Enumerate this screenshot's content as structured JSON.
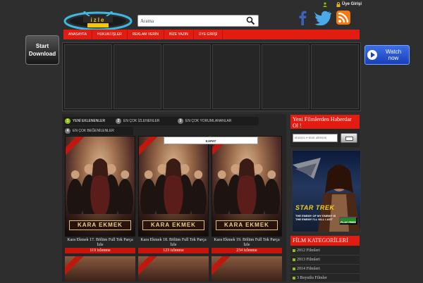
{
  "header": {
    "logo_text": "izle",
    "search": {
      "placeholder": "Arama",
      "value": "Arama"
    },
    "user_link": "Üye Girişi"
  },
  "nav": {
    "items": [
      "ANASAYFA",
      "HUKUKİ İŞLER",
      "REKLAM VERİN",
      "BİZE YAZIN",
      "ÜYE GİRİŞİ"
    ]
  },
  "ads": {
    "start_download": "Start Download",
    "watch_now": "Watch now",
    "startrek": {
      "logo": "STAR TREK",
      "tagline": "THE ENEMY OF MY ENEMY IS THE ENEMY I'LL KILL LAST",
      "play": "PLAY FREE"
    }
  },
  "tabs": [
    {
      "num": "1",
      "label": "YENİ EKLENENLER"
    },
    {
      "num": "2",
      "label": "EN ÇOK İZLENENLER"
    },
    {
      "num": "3",
      "label": "EN ÇOK YORUMLANANLAR"
    },
    {
      "num": "4",
      "label": "EN ÇOK BEĞENİLENLER"
    }
  ],
  "popup": {
    "close_label": "KAPAT"
  },
  "movies": [
    {
      "poster_title": "KARA EKMEK",
      "title": "Kara Ekmek 17. Bölüm Full Tek Parça İzle",
      "views": "119 izlenme"
    },
    {
      "poster_title": "KARA EKMEK",
      "title": "Kara Ekmek 18. Bölüm Full Tek Parça İzle",
      "views": "123 izlenme"
    },
    {
      "poster_title": "KARA EKMEK",
      "title": "Kara Ekmek 19. Bölüm Full Tek Parça İzle",
      "views": "234 izlenme"
    }
  ],
  "newsletter": {
    "title": "Yeni Filmlerden Haberdar Ol !",
    "placeholder": "Buraya e-mail adresini"
  },
  "categories": {
    "title": "FİLM KATEGORİLERİ",
    "items": [
      "2012 Filmleri",
      "2013 Filmleri",
      "2014 Filmleri",
      "3 Boyutlu Filmler"
    ]
  },
  "colors": {
    "accent_red": "#e21c10",
    "tab_active_green": "#8bbf12",
    "page_bg": "#2e2e2e"
  }
}
